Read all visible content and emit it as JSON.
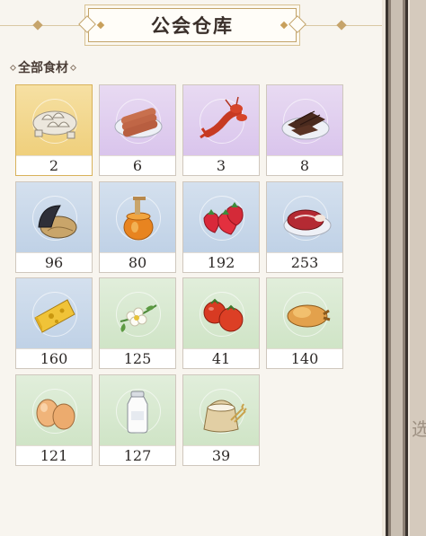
{
  "window": {
    "title": "公会仓库"
  },
  "section": {
    "label": "全部食材"
  },
  "items": [
    {
      "name": "dumplings",
      "count": "2",
      "tint": "gold"
    },
    {
      "name": "sausages",
      "count": "6",
      "tint": "purple"
    },
    {
      "name": "lobster",
      "count": "3",
      "tint": "purple"
    },
    {
      "name": "chocolate",
      "count": "8",
      "tint": "purple"
    },
    {
      "name": "mussels",
      "count": "96",
      "tint": "blue"
    },
    {
      "name": "honey",
      "count": "80",
      "tint": "blue"
    },
    {
      "name": "strawberries",
      "count": "192",
      "tint": "blue"
    },
    {
      "name": "meat",
      "count": "253",
      "tint": "blue"
    },
    {
      "name": "cheese",
      "count": "160",
      "tint": "blue"
    },
    {
      "name": "flowers",
      "count": "125",
      "tint": "green"
    },
    {
      "name": "tomatoes",
      "count": "41",
      "tint": "green"
    },
    {
      "name": "chicken",
      "count": "140",
      "tint": "green"
    },
    {
      "name": "eggs",
      "count": "121",
      "tint": "green"
    },
    {
      "name": "milk",
      "count": "127",
      "tint": "green"
    },
    {
      "name": "flour",
      "count": "39",
      "tint": "green"
    }
  ],
  "side": {
    "glyph": "选"
  }
}
